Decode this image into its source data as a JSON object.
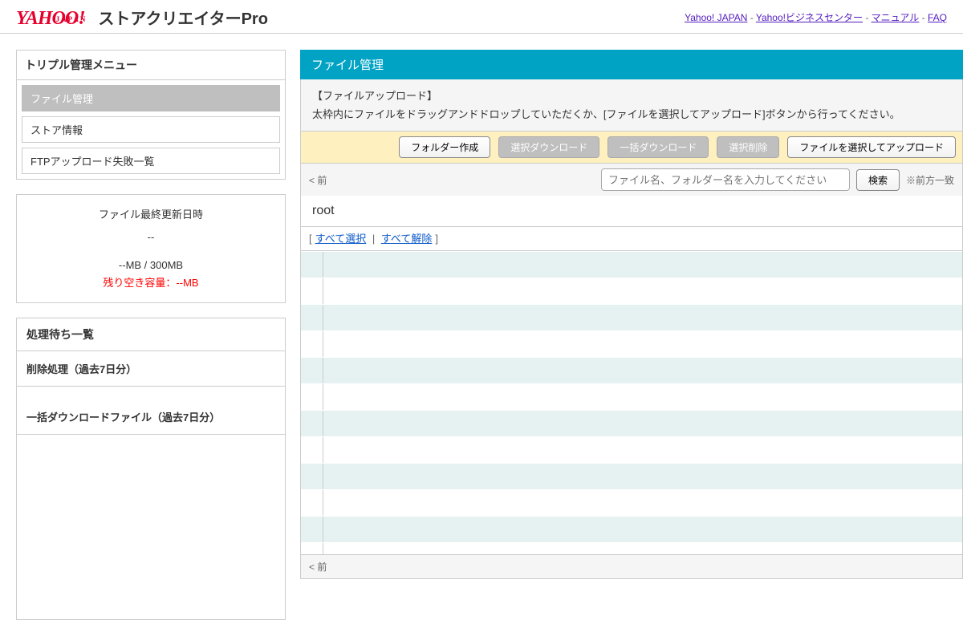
{
  "logo": {
    "brand": "YAHOO!",
    "japan": "JAPAN",
    "product": "ストアクリエイター",
    "pro": "Pro"
  },
  "topnav": {
    "yj": "Yahoo! JAPAN",
    "biz": "Yahoo!ビジネスセンター",
    "manual": "マニュアル",
    "faq": "FAQ",
    "sep": " - "
  },
  "sidebar": {
    "menu_title": "トリプル管理メニュー",
    "items": [
      {
        "label": "ファイル管理",
        "active": true
      },
      {
        "label": "ストア情報",
        "active": false
      },
      {
        "label": "FTPアップロード失敗一覧",
        "active": false
      }
    ],
    "fileinfo": {
      "title": "ファイル最終更新日時",
      "value": "--",
      "quota": "--MB / 300MB",
      "remain": "残り空き容量：--MB"
    },
    "queue": {
      "title": "処理待ち一覧",
      "items": [
        {
          "label": "削除処理（過去7日分）"
        },
        {
          "label": "一括ダウンロードファイル（過去7日分）"
        }
      ]
    }
  },
  "main": {
    "title": "ファイル管理",
    "upload": {
      "heading": "【ファイルアップロード】",
      "desc": "太枠内にファイルをドラッグアンドドロップしていただくか、[ファイルを選択してアップロード]ボタンから行ってください。"
    },
    "toolbar": {
      "create_folder": "フォルダー作成",
      "dl_selected": "選択ダウンロード",
      "dl_bulk": "一括ダウンロード",
      "del_selected": "選択削除",
      "upload": "ファイルを選択してアップロード"
    },
    "search": {
      "back": "< 前",
      "placeholder": "ファイル名、フォルダー名を入力してください",
      "button": "検索",
      "hint": "※前方一致"
    },
    "breadcrumb": "root",
    "select": {
      "open": "[",
      "all": "すべて選択",
      "sep": " | ",
      "none": "すべて解除",
      "close": "]"
    },
    "bottom_back": "< 前"
  }
}
